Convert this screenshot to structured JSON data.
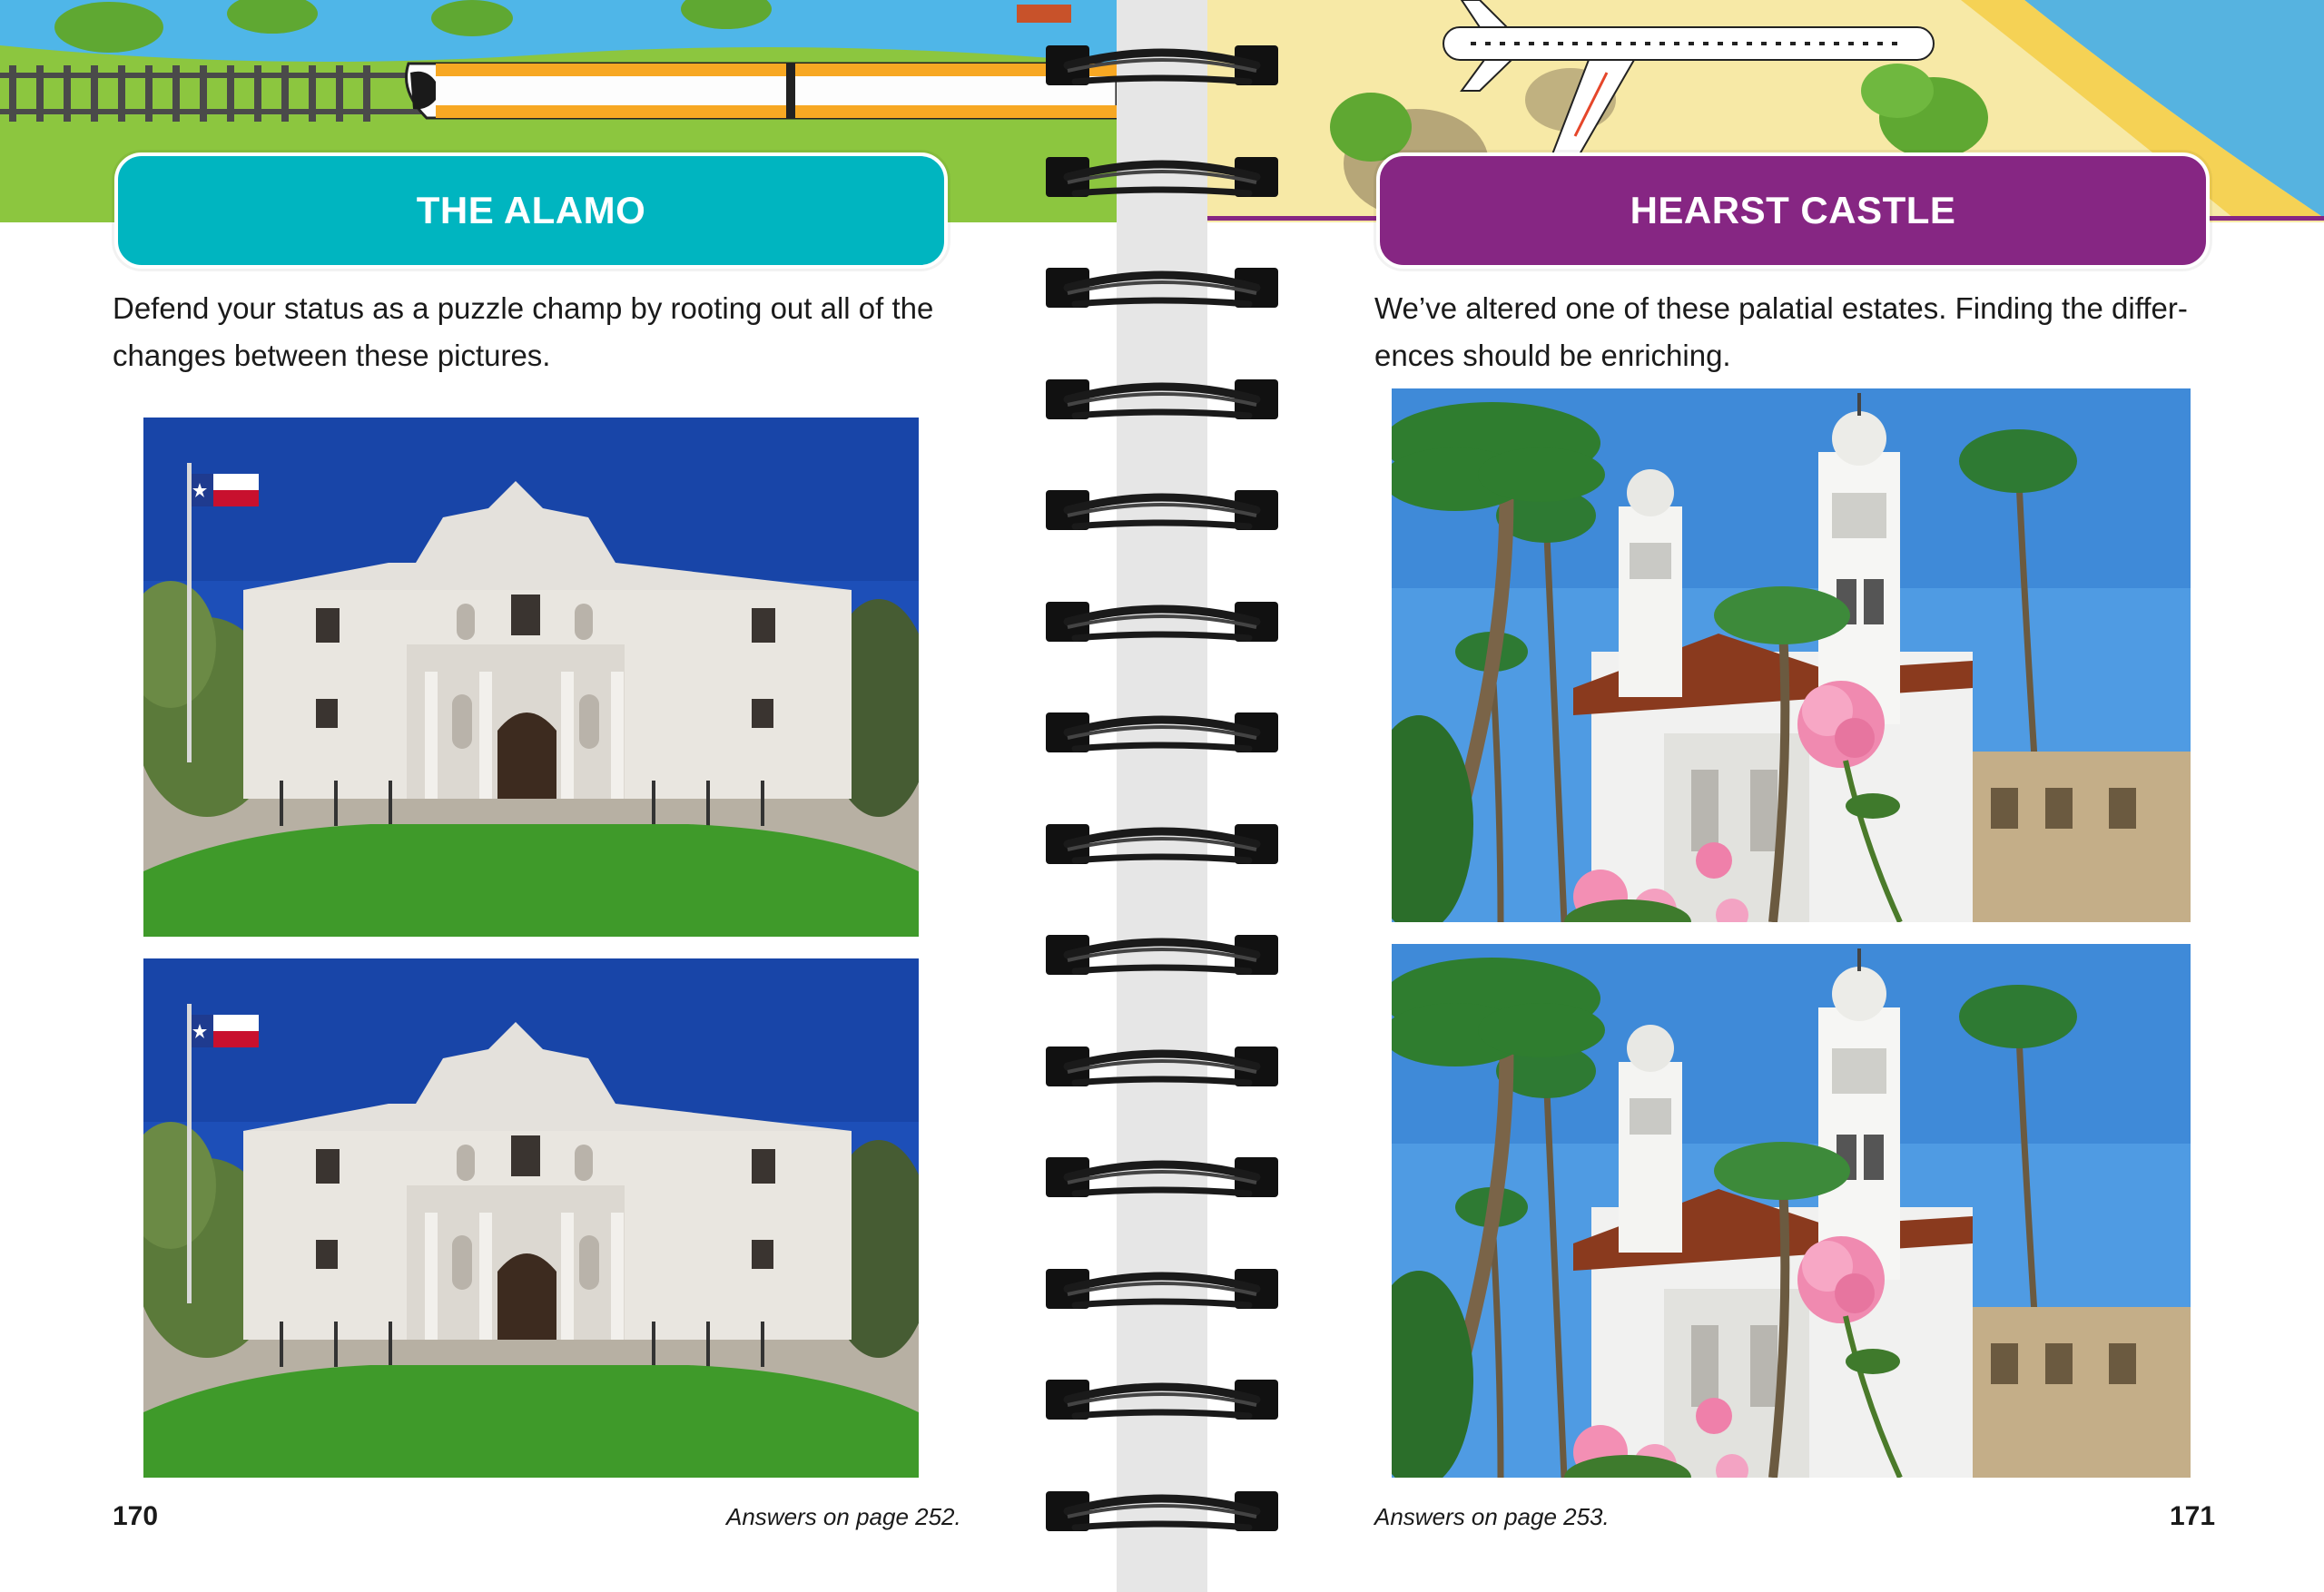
{
  "left_page": {
    "title": "THE ALAMO",
    "intro_line1": "Defend your status as a puzzle champ by rooting out all of the",
    "intro_line2": "changes between these pictures.",
    "page_number": "170",
    "answers": "Answers on page 252.",
    "accent_color": "#00b5c0",
    "photo_subject": "The Alamo mission facade with Texas flag",
    "flag_icon": "texas-flag-icon"
  },
  "right_page": {
    "title": "HEARST CASTLE",
    "intro_line1": "We’ve altered one of these palatial estates. Finding the differ-",
    "intro_line2": "ences should be enriching.",
    "page_number": "171",
    "answers": "Answers on page 253.",
    "accent_color": "#862683",
    "photo_subject": "Hearst Castle towers with palm trees and pink roses"
  },
  "header_art": {
    "left_icon": "train-icon",
    "right_icon": "airplane-icon"
  },
  "binding": {
    "icon": "spiral-coil-icon",
    "ring_count": 14
  }
}
